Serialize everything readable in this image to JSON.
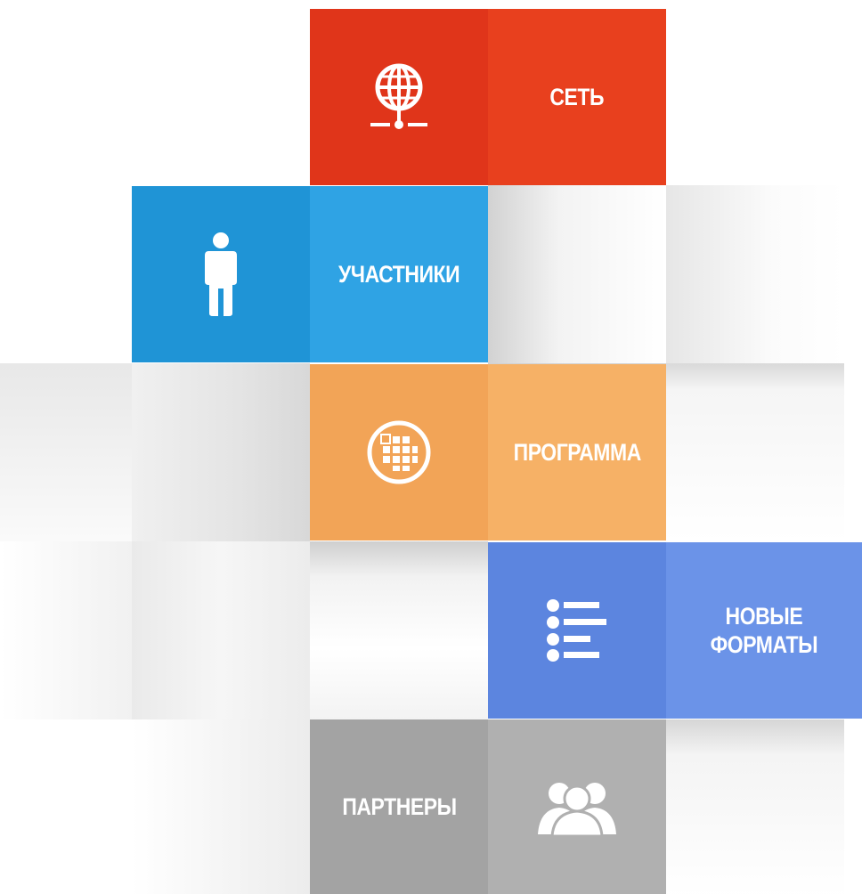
{
  "menu": {
    "tiles": [
      {
        "id": "network",
        "label": "СЕТЬ",
        "icon": "globe-network-icon",
        "color_dark": "#e0351a",
        "color_light": "#e8401e"
      },
      {
        "id": "participants",
        "label": "УЧАСТНИКИ",
        "icon": "person-icon",
        "color_dark": "#1f94d6",
        "color_light": "#2fa3e4"
      },
      {
        "id": "program",
        "label": "ПРОГРАММА",
        "icon": "program-grid-icon",
        "color_dark": "#f2a457",
        "color_light": "#f6b166"
      },
      {
        "id": "new-formats",
        "label": "НОВЫЕ\nФОРМАТЫ",
        "icon": "list-icon",
        "color_dark": "#5c85df",
        "color_light": "#6b93e8"
      },
      {
        "id": "partners",
        "label": "ПАРТНЕРЫ",
        "icon": "group-people-icon",
        "color_dark": "#a3a3a3",
        "color_light": "#b0b0b0"
      }
    ]
  }
}
